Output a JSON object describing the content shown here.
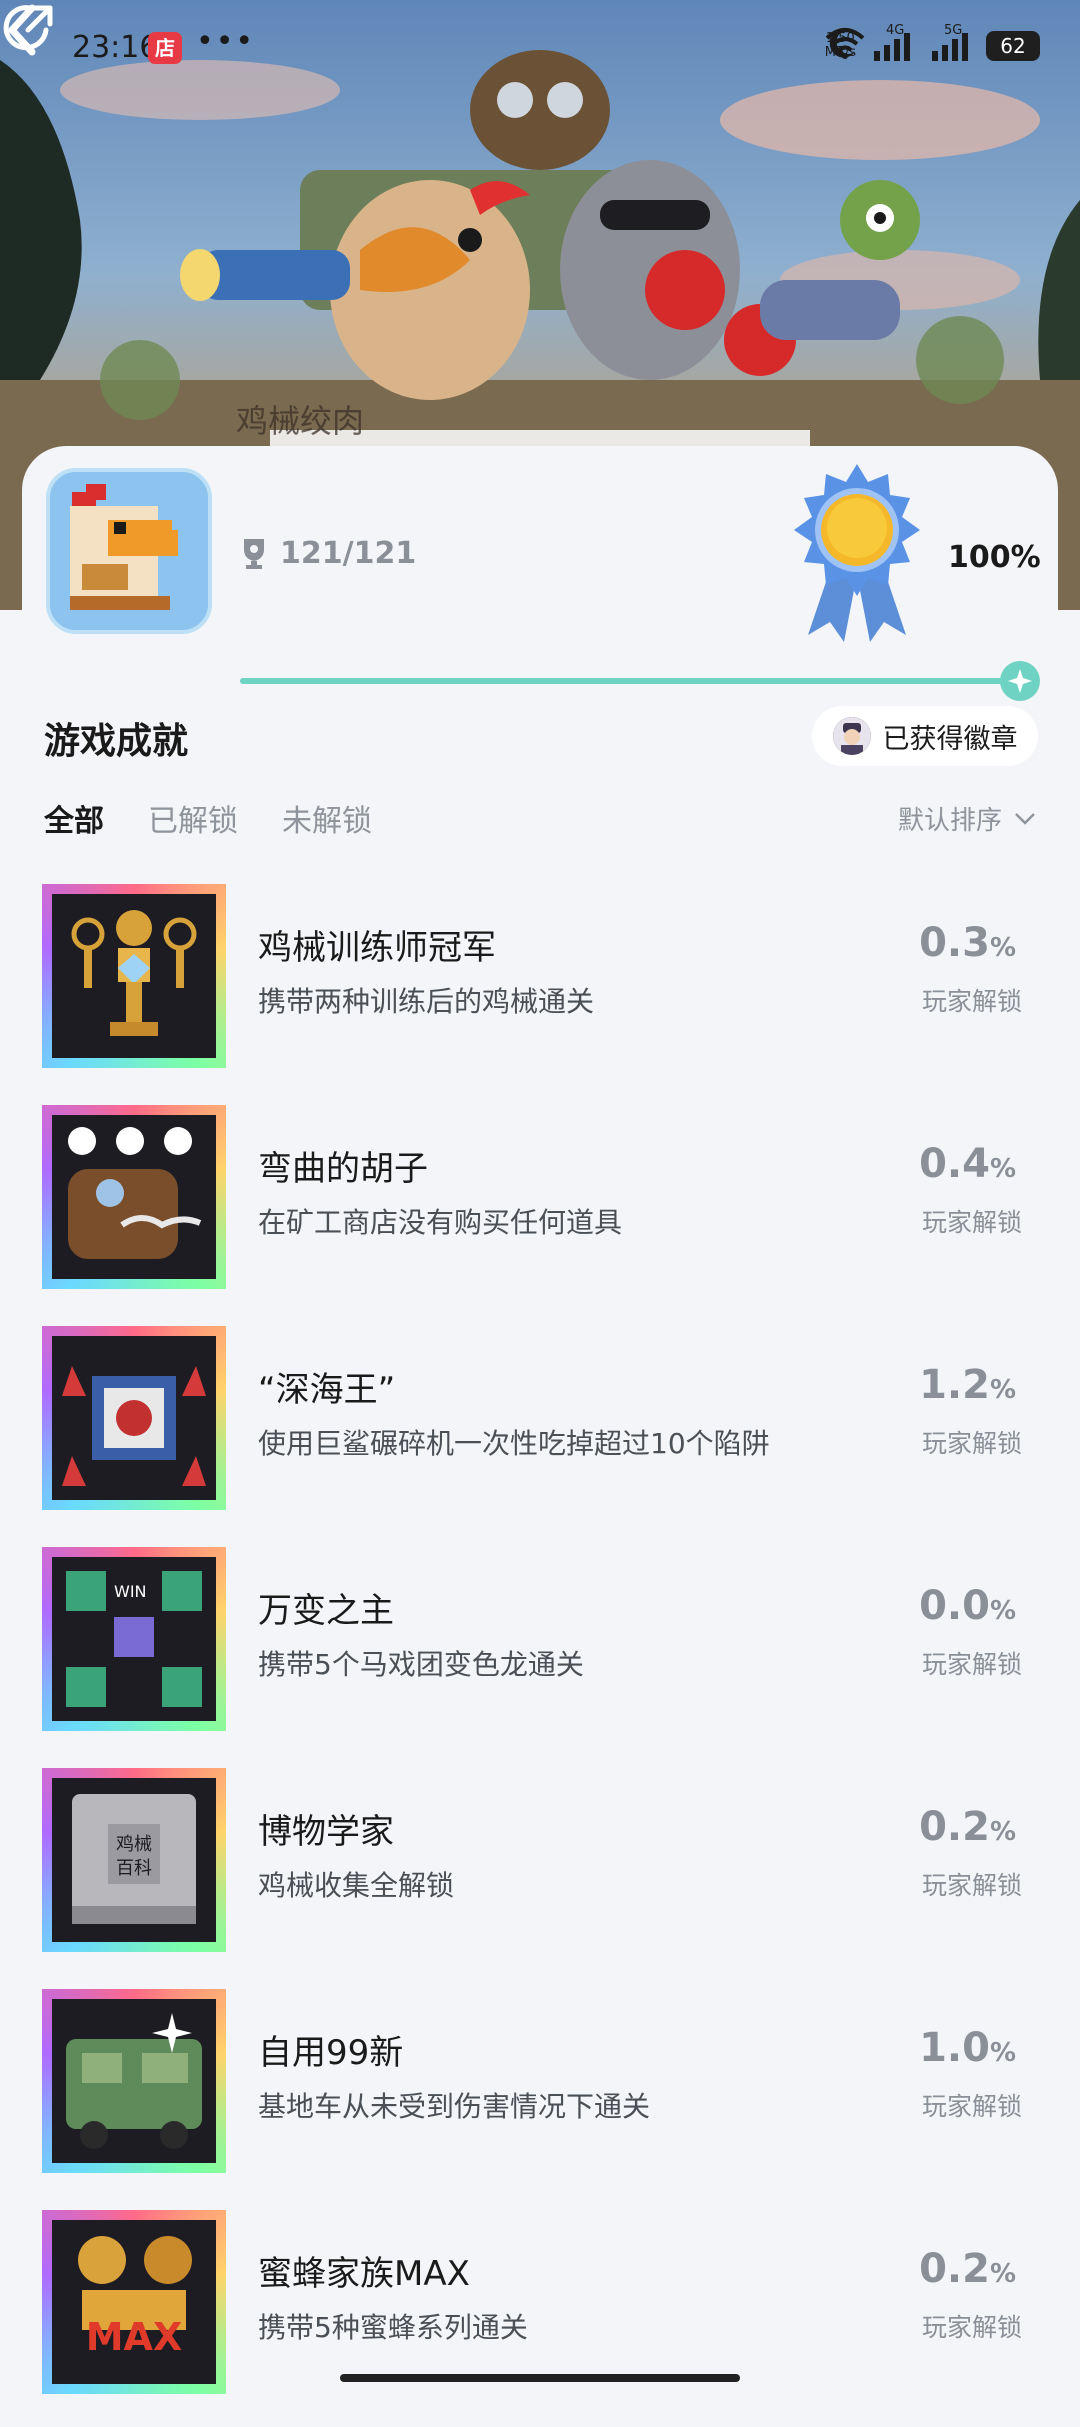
{
  "status_bar": {
    "time": "23:16",
    "store_badge": "店",
    "dots": "•••",
    "net_speed_value": "1.50",
    "net_speed_unit": "MB/s",
    "network_1": "4G",
    "network_2": "5G",
    "battery": "62"
  },
  "hero": {
    "subtitle": "鸡械绞肉"
  },
  "summary": {
    "trophy_count": "121/121",
    "percent": "100%",
    "progress": 1.0
  },
  "section": {
    "title": "游戏成就",
    "badge_button": "已获得徽章",
    "tabs": [
      "全部",
      "已解锁",
      "未解锁"
    ],
    "sort_label": "默认排序"
  },
  "achievements": [
    {
      "title": "鸡械训练师冠军",
      "description": "携带两种训练后的鸡械通关",
      "rate": "0.3",
      "unit": "%",
      "rate_label": "玩家解锁"
    },
    {
      "title": "弯曲的胡子",
      "description": "在矿工商店没有购买任何道具",
      "rate": "0.4",
      "unit": "%",
      "rate_label": "玩家解锁"
    },
    {
      "title": "“深海王”",
      "description": "使用巨鲨碾碎机一次性吃掉超过10个陷阱",
      "rate": "1.2",
      "unit": "%",
      "rate_label": "玩家解锁"
    },
    {
      "title": "万变之主",
      "description": "携带5个马戏团变色龙通关",
      "rate": "0.0",
      "unit": "%",
      "rate_label": "玩家解锁"
    },
    {
      "title": "博物学家",
      "description": "鸡械收集全解锁",
      "rate": "0.2",
      "unit": "%",
      "rate_label": "玩家解锁"
    },
    {
      "title": "自用99新",
      "description": "基地车从未受到伤害情况下通关",
      "rate": "1.0",
      "unit": "%",
      "rate_label": "玩家解锁"
    },
    {
      "title": "蜜蜂家族MAX",
      "description": "携带5种蜜蜂系列通关",
      "rate": "0.2",
      "unit": "%",
      "rate_label": "玩家解锁"
    }
  ],
  "thumb_texts": {
    "museum_line1": "鸡械",
    "museum_line2": "百科",
    "bee_max": "MAX",
    "win": "WIN"
  },
  "colors": {
    "accent": "#6fd3c3",
    "background": "#f3f5f8",
    "muted_text": "#8a8f98"
  }
}
